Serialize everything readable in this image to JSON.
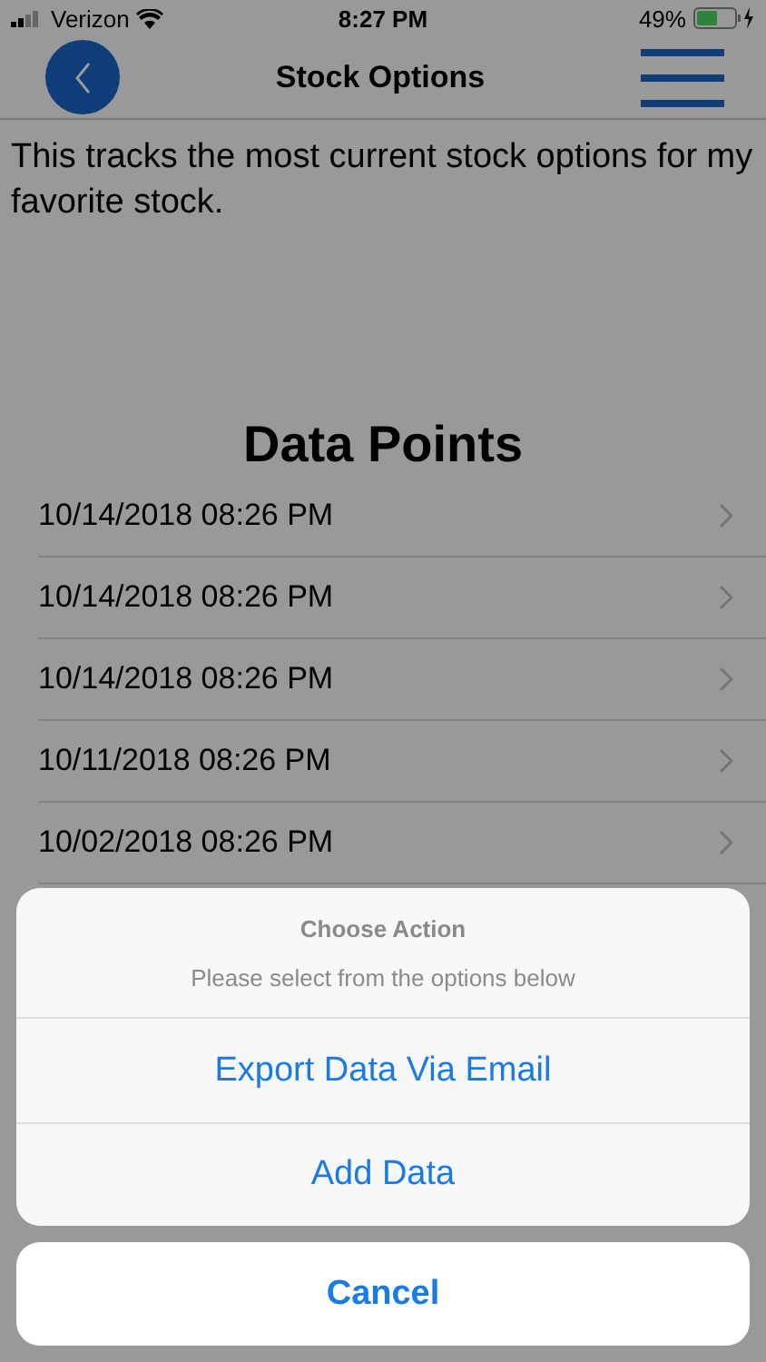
{
  "status_bar": {
    "carrier": "Verizon",
    "time": "8:27 PM",
    "battery": "49%"
  },
  "nav": {
    "title": "Stock Options"
  },
  "description": "This tracks the most current stock options for my favorite stock.",
  "section_title": "Data Points",
  "data_points": [
    {
      "label": "10/14/2018 08:26 PM"
    },
    {
      "label": "10/14/2018 08:26 PM"
    },
    {
      "label": "10/14/2018 08:26 PM"
    },
    {
      "label": "10/11/2018 08:26 PM"
    },
    {
      "label": "10/02/2018 08:26 PM"
    }
  ],
  "action_sheet": {
    "title": "Choose Action",
    "message": "Please select from the options below",
    "actions": [
      {
        "label": "Export Data Via Email"
      },
      {
        "label": "Add Data"
      }
    ],
    "cancel": "Cancel"
  }
}
